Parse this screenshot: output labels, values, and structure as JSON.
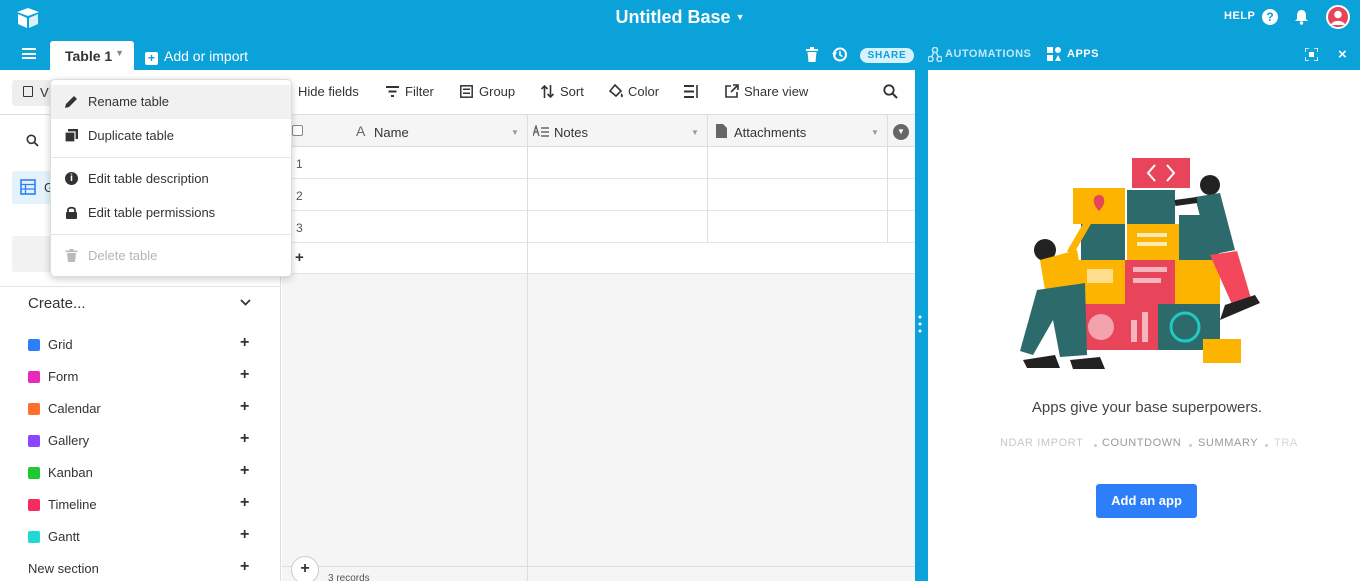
{
  "app": {
    "base_title": "Untitled Base"
  },
  "topbar": {
    "help": "HELP"
  },
  "tabs": {
    "active": "Table 1",
    "add_or_import": "Add or import"
  },
  "header_right": {
    "share": "SHARE",
    "automations": "AUTOMATIONS",
    "apps": "APPS"
  },
  "toolbar": {
    "views_label": "V",
    "hide_fields": "Hide fields",
    "filter": "Filter",
    "group": "Group",
    "sort": "Sort",
    "color": "Color",
    "share_view": "Share view"
  },
  "table_menu": {
    "items": [
      {
        "label": "Rename table"
      },
      {
        "label": "Duplicate table"
      },
      {
        "label": "Edit table description"
      },
      {
        "label": "Edit table permissions"
      },
      {
        "label": "Delete table"
      }
    ]
  },
  "grid": {
    "columns": [
      "Name",
      "Notes",
      "Attachments"
    ],
    "rows": [
      "1",
      "2",
      "3"
    ],
    "add_row": "+",
    "record_count": "3 records"
  },
  "sidebar": {
    "view_item_initial": "G",
    "create_label": "Create...",
    "create_items": [
      {
        "label": "Grid",
        "color": "#2d7ff9"
      },
      {
        "label": "Form",
        "color": "#e929ba"
      },
      {
        "label": "Calendar",
        "color": "#ff6f2c"
      },
      {
        "label": "Gallery",
        "color": "#8b46ff"
      },
      {
        "label": "Kanban",
        "color": "#20c933"
      },
      {
        "label": "Timeline",
        "color": "#f82b60"
      },
      {
        "label": "Gantt",
        "color": "#20d9d2"
      }
    ],
    "new_section": "New section"
  },
  "apps_panel": {
    "tagline": "Apps give your base superpowers.",
    "carousel": [
      "NDAR IMPORT",
      "COUNTDOWN",
      "SUMMARY",
      "TRA"
    ],
    "add_app": "Add an app"
  },
  "colors": {
    "brand": "#0aa2d9",
    "button_blue": "#2d7ff9"
  }
}
